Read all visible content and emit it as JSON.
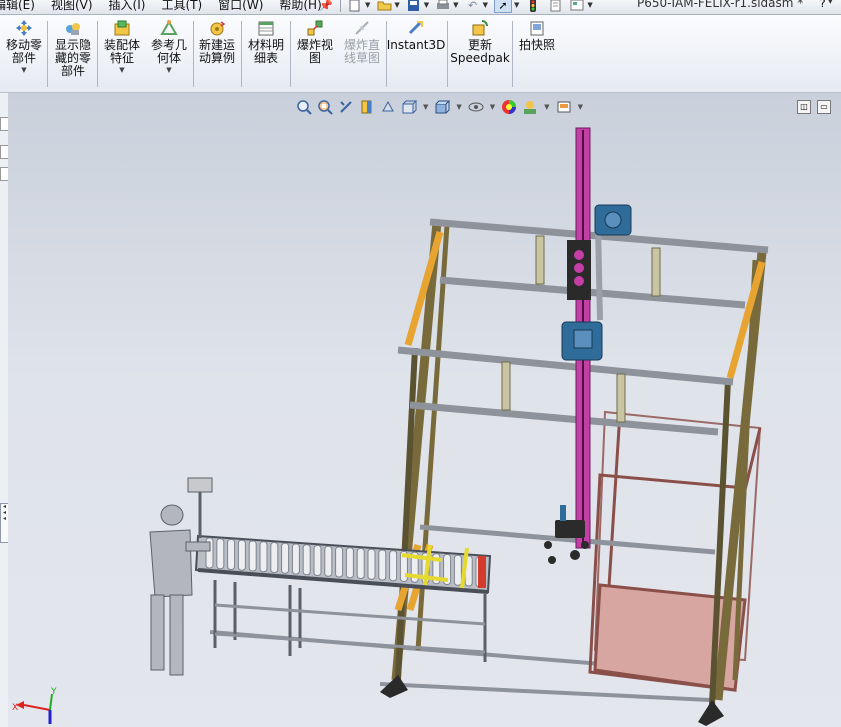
{
  "menubar": {
    "items": [
      "编辑(E)",
      "视图(V)",
      "插入(I)",
      "工具(T)",
      "窗口(W)",
      "帮助(H)"
    ],
    "document_title": "P650-IAM-FELIX-r1.sldasm *"
  },
  "commands": [
    {
      "label": "移动零\n部件",
      "icon": "move-component-icon",
      "dropdown": true
    },
    {
      "label": "显示隐\n藏的零\n部件",
      "icon": "show-hidden-components-icon",
      "dropdown": false
    },
    {
      "label": "装配体\n特征",
      "icon": "assembly-features-icon",
      "dropdown": true
    },
    {
      "label": "参考几\n何体",
      "icon": "reference-geometry-icon",
      "dropdown": true
    },
    {
      "label": "新建运\n动算例",
      "icon": "new-motion-study-icon",
      "dropdown": false
    },
    {
      "label": "材料明\n细表",
      "icon": "bill-of-materials-icon",
      "dropdown": false
    },
    {
      "label": "爆炸视\n图",
      "icon": "exploded-view-icon",
      "dropdown": false
    },
    {
      "label": "爆炸直\n线草图",
      "icon": "explode-line-sketch-icon",
      "dropdown": false,
      "disabled": true
    },
    {
      "label": "Instant3D",
      "icon": "instant3d-icon",
      "dropdown": false
    },
    {
      "label": "更新\nSpeedpak",
      "icon": "update-speedpak-icon",
      "dropdown": false
    },
    {
      "label": "拍快照",
      "icon": "take-snapshot-icon",
      "dropdown": false
    }
  ],
  "colors": {
    "frame_yellow": "#e8a431",
    "frame_post": "#786a3a",
    "rail_gray": "#8e929b",
    "mast_magenta": "#c43ea6",
    "carriage_blue": "#2f6c9a",
    "pallet_pink": "#d7a6a0",
    "conveyor_roller": "#eceef2",
    "accent_red": "#d33b2c"
  },
  "triad": {
    "x": "X",
    "y": "Y"
  }
}
